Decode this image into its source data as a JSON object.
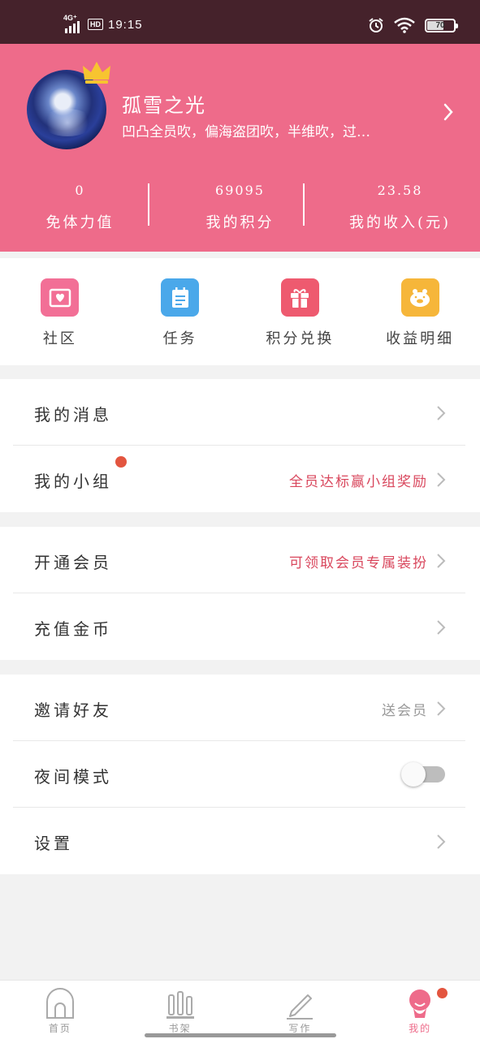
{
  "status_bar": {
    "network": "4G⁺",
    "hd": "HD",
    "time": "19:15",
    "battery": "70"
  },
  "profile": {
    "nickname": "孤雪之光",
    "signature": "凹凸全员吹，偏海盗团吹，半维吹，过…",
    "stats": [
      {
        "value": "0",
        "label": "免体力值"
      },
      {
        "value": "69095",
        "label": "我的积分"
      },
      {
        "value": "23.58",
        "label": "我的收入(元)"
      }
    ]
  },
  "shortcuts": [
    {
      "label": "社区",
      "color": "#f26f96",
      "icon": "heart-envelope-icon"
    },
    {
      "label": "任务",
      "color": "#4aa8ea",
      "icon": "notepad-icon"
    },
    {
      "label": "积分兑换",
      "color": "#ee5a6f",
      "icon": "gift-icon"
    },
    {
      "label": "收益明细",
      "color": "#f6b63a",
      "icon": "piggy-bank-icon"
    }
  ],
  "menu": {
    "messages": {
      "label": "我的消息"
    },
    "groups": {
      "label": "我的小组",
      "value": "全员达标赢小组奖励"
    },
    "vip": {
      "label": "开通会员",
      "value": "可领取会员专属装扮"
    },
    "coins": {
      "label": "充值金币"
    },
    "invite": {
      "label": "邀请好友",
      "value": "送会员"
    },
    "night": {
      "label": "夜间模式",
      "enabled": false
    },
    "settings": {
      "label": "设置"
    }
  },
  "bottom_nav": [
    {
      "label": "首页",
      "icon": "home-icon"
    },
    {
      "label": "书架",
      "icon": "bookshelf-icon"
    },
    {
      "label": "写作",
      "icon": "pencil-icon"
    },
    {
      "label": "我的",
      "icon": "profile-icon",
      "active": true
    }
  ],
  "colors": {
    "accent": "#ee6b8a",
    "status_bar": "#45222b",
    "highlight_text": "#d9475d",
    "badge": "#e3553f"
  }
}
